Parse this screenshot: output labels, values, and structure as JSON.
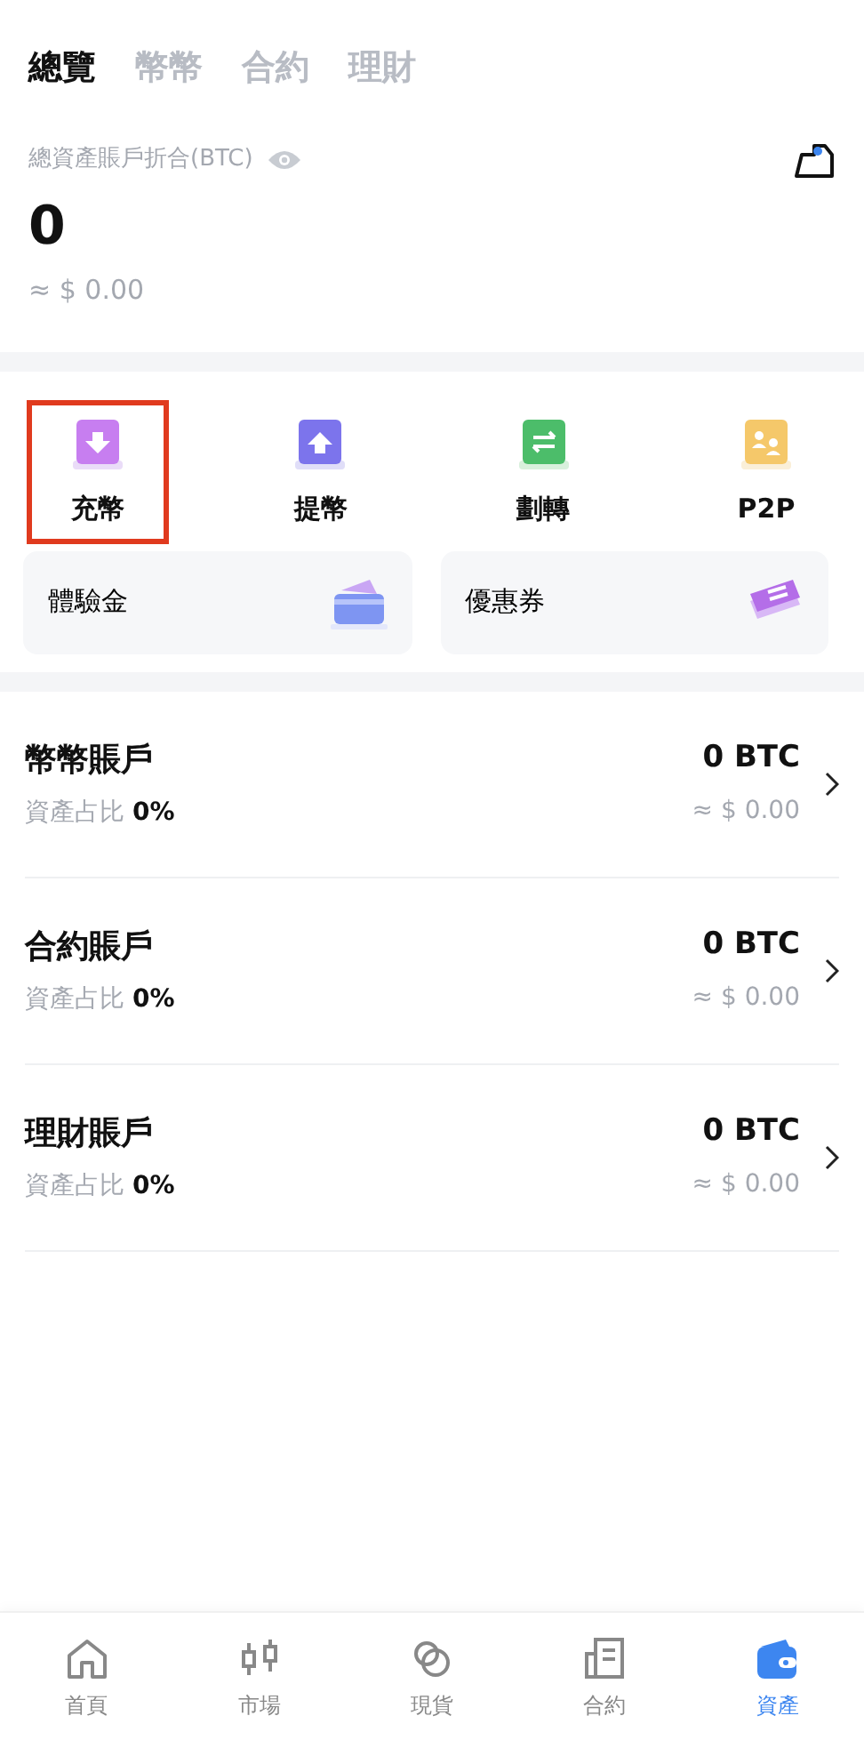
{
  "tabs": [
    {
      "label": "總覽",
      "selected": true
    },
    {
      "label": "幣幣",
      "selected": false
    },
    {
      "label": "合約",
      "selected": false
    },
    {
      "label": "理財",
      "selected": false
    }
  ],
  "summary": {
    "label": "總資產賬戶折合(BTC)",
    "amount": "0",
    "fiat": "≈ $ 0.00"
  },
  "actions": [
    {
      "label": "充幣",
      "highlighted": true
    },
    {
      "label": "提幣",
      "highlighted": false
    },
    {
      "label": "劃轉",
      "highlighted": false
    },
    {
      "label": "P2P",
      "highlighted": false
    }
  ],
  "cards": [
    {
      "label": "體驗金"
    },
    {
      "label": "優惠券"
    }
  ],
  "accounts": [
    {
      "name": "幣幣賬戶",
      "share": "資產占比 **0%**",
      "amount": "0 BTC",
      "fiat": "≈ $ 0.00"
    },
    {
      "name": "合約賬戶",
      "share": "資產占比 **0%**",
      "amount": "0 BTC",
      "fiat": "≈ $ 0.00"
    },
    {
      "name": "理財賬戶",
      "share": "資產占比 **0%**",
      "amount": "0 BTC",
      "fiat": "≈ $ 0.00"
    }
  ],
  "bottom_nav": [
    {
      "label": "首頁",
      "selected": false
    },
    {
      "label": "市場",
      "selected": false
    },
    {
      "label": "現貨",
      "selected": false
    },
    {
      "label": "合約",
      "selected": false
    },
    {
      "label": "資產",
      "selected": true
    }
  ]
}
